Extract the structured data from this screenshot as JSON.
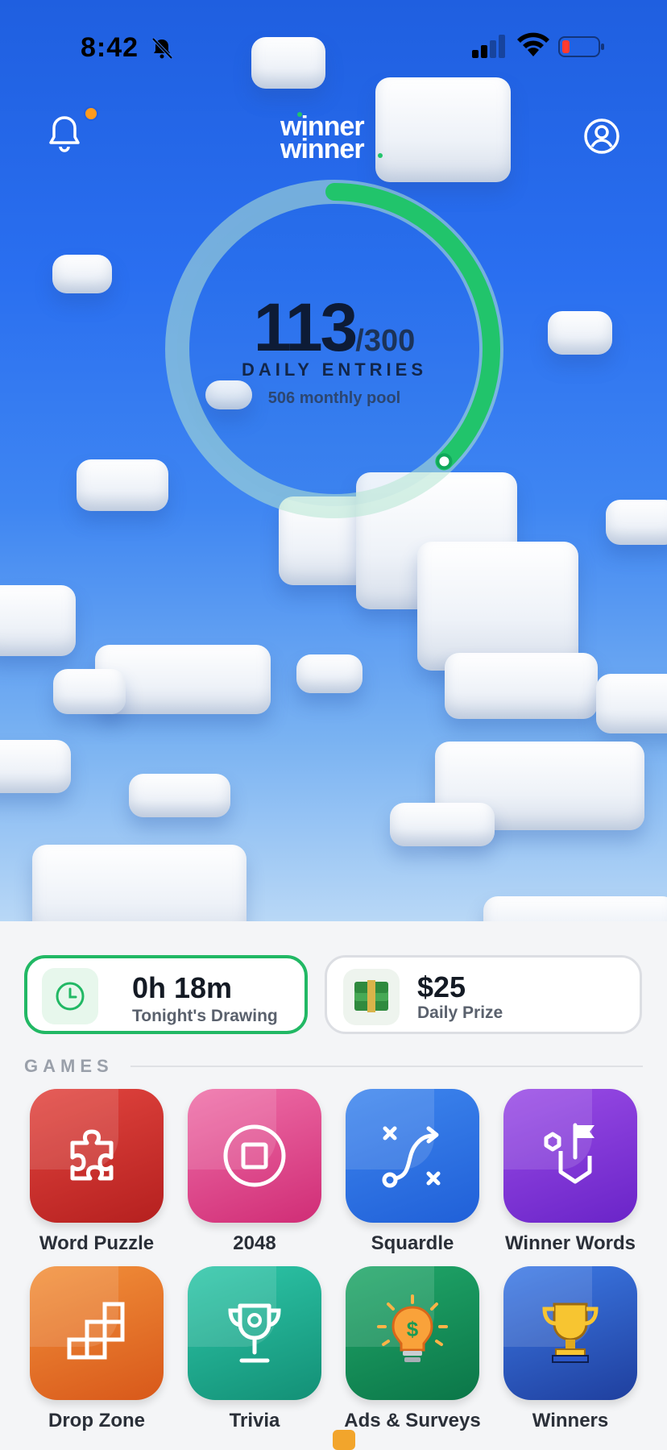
{
  "status_bar": {
    "time": "8:42",
    "icons": [
      "bell-slash-icon",
      "cellular-signal-icon",
      "wifi-icon",
      "battery-low-icon"
    ]
  },
  "header": {
    "logo_line1": "winner",
    "logo_line2": "winner",
    "notification_dot_color": "#ff9b1c",
    "icons": [
      "bell-icon",
      "profile-icon"
    ]
  },
  "progress": {
    "current": "113",
    "max": "/300",
    "current_value": 113,
    "max_value": 300,
    "label": "DAILY ENTRIES",
    "pool": "506 monthly pool",
    "ring_color": "#21c46b"
  },
  "cards": {
    "drawing": {
      "title": "0h 18m",
      "subtitle": "Tonight's Drawing",
      "icon": "clock-icon",
      "accent": "#21b864"
    },
    "prize": {
      "title": "$25",
      "subtitle": "Daily Prize",
      "icon": "money-stack-icon"
    }
  },
  "games": {
    "section_label": "GAMES",
    "items": [
      {
        "label": "Word Puzzle",
        "icon": "puzzle-piece-icon",
        "color": "#c9302c"
      },
      {
        "label": "2048",
        "icon": "stop-circle-icon",
        "color": "#e04c8e"
      },
      {
        "label": "Squardle",
        "icon": "strategy-path-icon",
        "color": "#2f73e4"
      },
      {
        "label": "Winner Words",
        "icon": "flag-hexagon-icon",
        "color": "#8038d8"
      },
      {
        "label": "Drop Zone",
        "icon": "blocks-icon",
        "color": "#e57428"
      },
      {
        "label": "Trivia",
        "icon": "trophy-icon",
        "color": "#20ab8f"
      },
      {
        "label": "Ads & Surveys",
        "icon": "lightbulb-dollar-icon",
        "color": "#168f58"
      },
      {
        "label": "Winners",
        "icon": "gold-trophy-icon",
        "color": "#2d5cc2"
      }
    ]
  }
}
